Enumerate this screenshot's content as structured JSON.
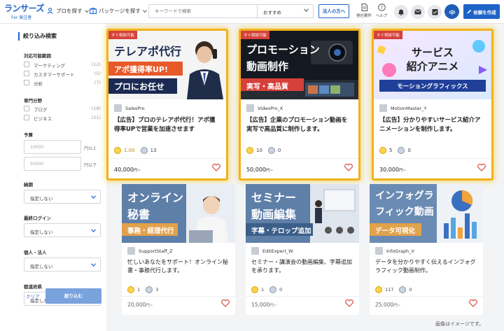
{
  "header": {
    "logo_main": "ランサーズ",
    "logo_sub": "For 発注者",
    "nav_find_pro": "プロを探す",
    "nav_find_package": "パッケージを探す",
    "search_placeholder": "キーワードで検索",
    "sort_value": "おすすめ",
    "corporate_button": "法人の方へ",
    "other_jobs": "他社案件",
    "help": "ヘルプ",
    "request_button": "依頼を作成",
    "colors": {
      "brand": "#1d63c8",
      "accent": "#f0b21c"
    }
  },
  "sidebar": {
    "title": "絞り込み検索",
    "available_range": {
      "label": "対応可能範囲",
      "options": [
        {
          "label": "マーケティング",
          "count": "(12)"
        },
        {
          "label": "カスタマーサポート",
          "count": "(5)"
        },
        {
          "label": "分析",
          "count": "(7)"
        }
      ]
    },
    "specialty": {
      "label": "専門分野",
      "options": [
        {
          "label": "ブログ",
          "count": "(18)"
        },
        {
          "label": "ビジネス",
          "count": "(21)"
        }
      ]
    },
    "budget": {
      "label": "予算",
      "min_placeholder": "10000",
      "min_unit": "円以上",
      "max_placeholder": "50000",
      "max_unit": "円以下"
    },
    "deadline": {
      "label": "納期",
      "value": "指定しない"
    },
    "last_login": {
      "label": "最終ログイン",
      "value": "指定しない"
    },
    "entity": {
      "label": "個人・法人",
      "value": "指定しない"
    },
    "prefecture": {
      "label": "都道府県",
      "value": "指定しない"
    },
    "clear": "クリア",
    "apply": "絞り込む"
  },
  "cards": [
    {
      "badge": "すぐ相談可能",
      "thumb_lines": [
        "テレアポ代行",
        "アポ獲得率UP!",
        "プロにお任せ"
      ],
      "user": "SalesPro",
      "title": "【広告】プロのテレアポ代行！アポ獲得率UPで営業を加速させます",
      "good": "1.00",
      "bad": "13",
      "price": "40,000",
      "price_suffix": "円~"
    },
    {
      "badge": "すぐ相談可能",
      "thumb_lines": [
        "プロモーション",
        "動画制作",
        "実写・高品質"
      ],
      "user": "VideoPro_X",
      "title": "【広告】企業のプロモーション動画を実写で高品質に制作します。",
      "good": "10",
      "bad": "0",
      "price": "50,000",
      "price_suffix": "円~"
    },
    {
      "badge": "すぐ相談可能",
      "thumb_lines": [
        "サービス",
        "紹介アニメ",
        "モーショングラフィックス"
      ],
      "user": "MotionMaster_Y",
      "title": "【広告】分かりやすいサービス紹介アニメーションを制作します。",
      "good": "5",
      "bad": "0",
      "price": "30,000",
      "price_suffix": "円~"
    },
    {
      "thumb_lines": [
        "オンライン",
        "秘書",
        "事務・経理代行"
      ],
      "user": "SupportStaff_Z",
      "title": "忙しいあなたをサポート！オンライン秘書・事務代行します。",
      "good": "1",
      "bad": "3",
      "price": "20,000",
      "price_suffix": "円~"
    },
    {
      "thumb_lines": [
        "セミナー",
        "動画編集",
        "字幕・テロップ追加"
      ],
      "user": "EditExpert_W",
      "title": "セミナー・講演会の動画編集、字幕追加を承ります。",
      "good": "1",
      "bad": "0",
      "price": "15,000",
      "price_suffix": "円~"
    },
    {
      "thumb_lines": [
        "インフォグラ",
        "フィック動画",
        "データ可視化"
      ],
      "user": "InfoGraph_V",
      "title": "データを分かりやすく伝えるインフォグラフィック動画制作。",
      "good": "117",
      "bad": "0",
      "price": "25,000",
      "price_suffix": "円~"
    }
  ],
  "footer_note": "画像はイメージです。"
}
